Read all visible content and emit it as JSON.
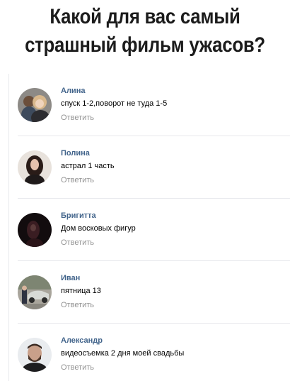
{
  "header": {
    "line1": "Какой для вас самый",
    "line2": "страшный фильм ужасов?"
  },
  "comments": [
    {
      "author": "Алина",
      "text": "спуск 1-2,поворот не туда 1-5",
      "reply": "Ответить"
    },
    {
      "author": "Полина",
      "text": "астрал 1 часть",
      "reply": "Ответить"
    },
    {
      "author": "Бригитта",
      "text": "Дом восковых фигур",
      "reply": "Ответить"
    },
    {
      "author": "Иван",
      "text": "пятница 13",
      "reply": "Ответить"
    },
    {
      "author": "Александр",
      "text": "видеосъемка 2 дня моей свадьбы",
      "reply": "Ответить"
    }
  ],
  "colors": {
    "author": "#42648b",
    "reply": "#939393",
    "divider": "#e7e8ec"
  }
}
